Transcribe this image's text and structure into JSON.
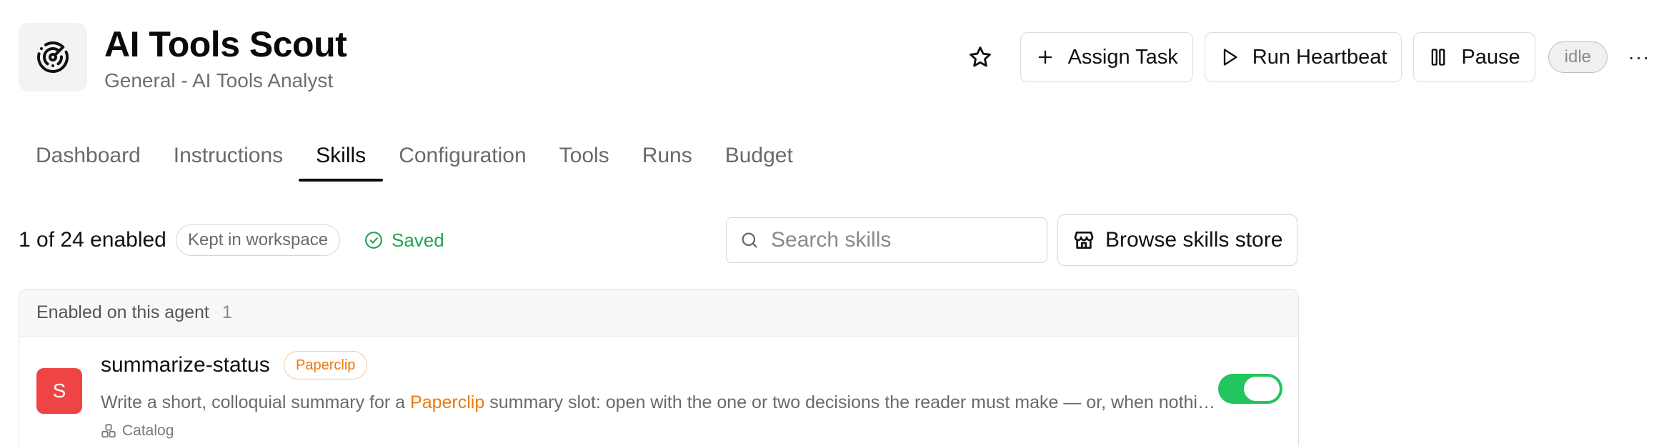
{
  "agent": {
    "title": "AI Tools Scout",
    "subtitle": "General - AI Tools Analyst",
    "icon": "radar-icon",
    "status": "idle"
  },
  "actions": {
    "assign_task_label": "Assign Task",
    "run_heartbeat_label": "Run Heartbeat",
    "pause_label": "Pause",
    "more_label": "···"
  },
  "tabs": [
    {
      "label": "Dashboard",
      "active": false
    },
    {
      "label": "Instructions",
      "active": false
    },
    {
      "label": "Skills",
      "active": true
    },
    {
      "label": "Configuration",
      "active": false
    },
    {
      "label": "Tools",
      "active": false
    },
    {
      "label": "Runs",
      "active": false
    },
    {
      "label": "Budget",
      "active": false
    }
  ],
  "toolbar": {
    "enabled_count": "1 of 24 enabled",
    "workspace_pill": "Kept in workspace",
    "saved_label": "Saved",
    "search_placeholder": "Search skills",
    "browse_label": "Browse skills store"
  },
  "panel": {
    "header_label": "Enabled on this agent",
    "header_count": "1",
    "skills": [
      {
        "avatar_letter": "S",
        "name": "summarize-status",
        "tag": "Paperclip",
        "desc_before": "Write a short, colloquial summary for a ",
        "desc_highlight": "Paperclip",
        "desc_after": " summary slot: open with the one or two decisions the reader must make — or, when nothing needs deciding, say so and describe the state of things plainly.",
        "source": "Catalog",
        "enabled": true
      }
    ]
  },
  "colors": {
    "accent_green": "#22c55e",
    "saved_green": "#22a352",
    "tag_orange": "#ea7a0c",
    "avatar_red": "#ef4444"
  }
}
